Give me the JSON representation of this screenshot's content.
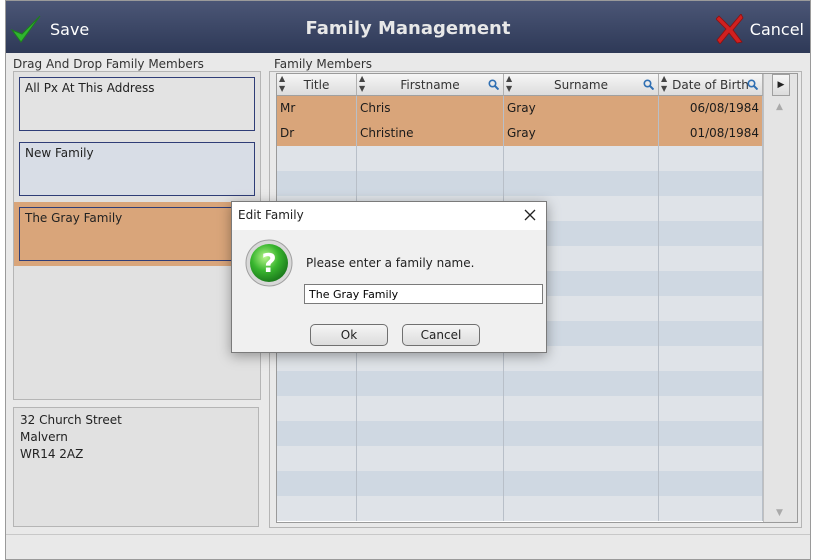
{
  "header": {
    "title": "Family Management",
    "save_label": "Save",
    "cancel_label": "Cancel"
  },
  "left": {
    "group_label": "Drag And Drop Family Members",
    "families": [
      {
        "name": "All Px At This Address",
        "bg": "#e3e3e3"
      },
      {
        "name": "New Family",
        "bg": "#d8dde6"
      },
      {
        "name": "The Gray Family",
        "bg": "#d9a57a"
      }
    ],
    "address": [
      "32 Church Street",
      "Malvern",
      "WR14 2AZ"
    ]
  },
  "right": {
    "group_label": "Family Members",
    "columns": [
      "Title",
      "Firstname",
      "Surname",
      "Date of Birth"
    ],
    "rows": [
      [
        "Mr",
        "Chris",
        "Gray",
        "06/08/1984"
      ],
      [
        "Dr",
        "Christine",
        "Gray",
        "01/08/1984"
      ]
    ],
    "more_icon": "triangle-right-icon"
  },
  "dialog": {
    "title": "Edit Family",
    "prompt": "Please enter a family name.",
    "value": "The Gray Family",
    "ok_label": "Ok",
    "cancel_label": "Cancel"
  },
  "colors": {
    "header": "#2e3957",
    "selection": "#d9a57a",
    "card_border": "#2f3d77",
    "icon_green": "#2fb52f",
    "icon_red": "#d02020"
  }
}
